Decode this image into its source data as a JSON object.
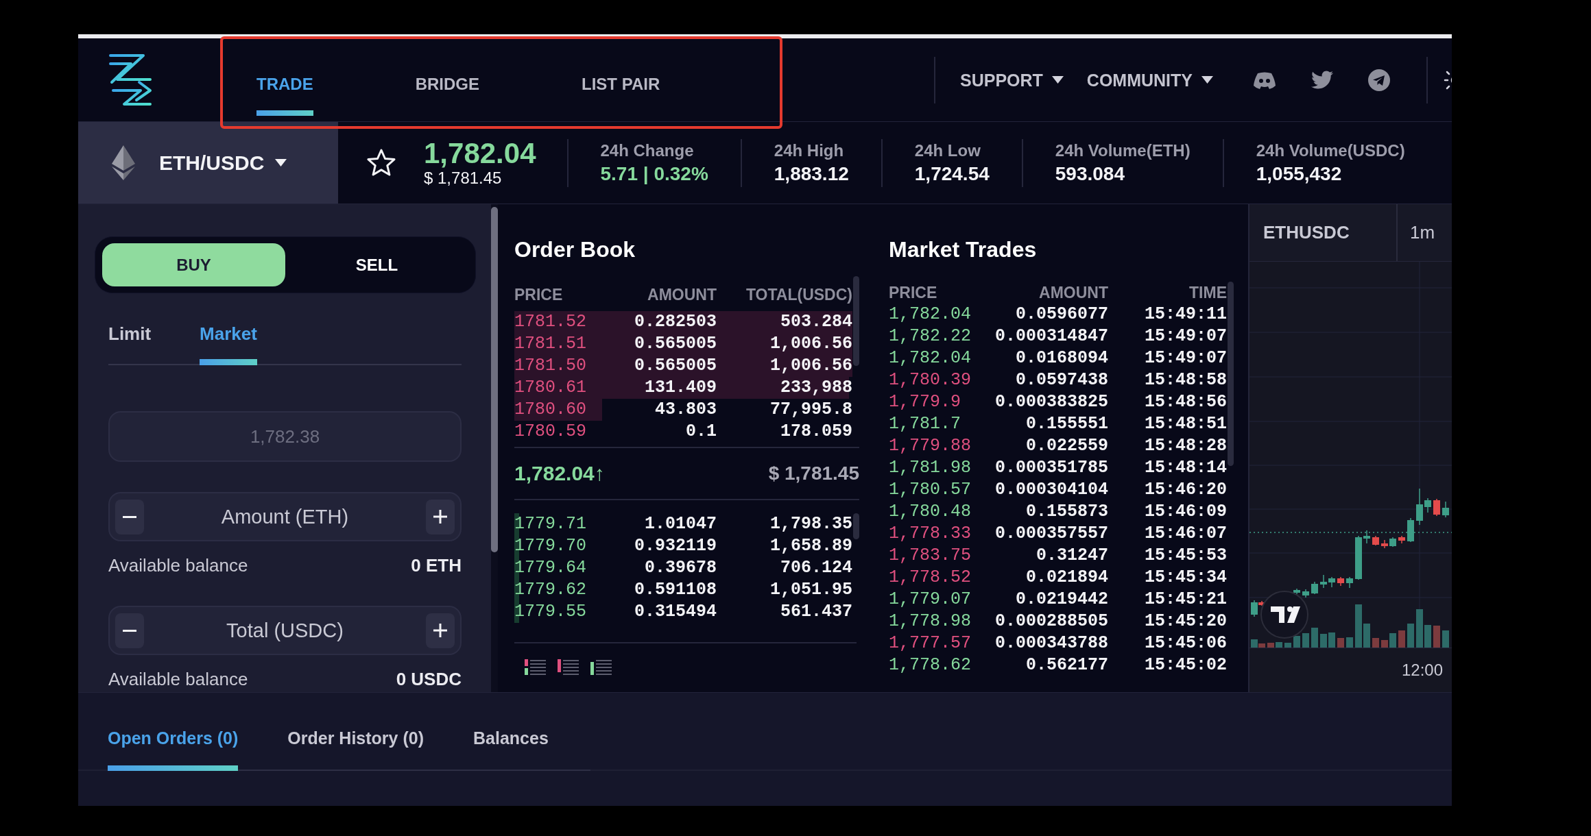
{
  "annotation": {
    "kind": "rectangle"
  },
  "header": {
    "nav_tabs": [
      {
        "label": "TRADE",
        "selected": true
      },
      {
        "label": "BRIDGE",
        "selected": false
      },
      {
        "label": "LIST PAIR",
        "selected": false
      }
    ],
    "menus": [
      {
        "label": "SUPPORT"
      },
      {
        "label": "COMMUNITY"
      }
    ]
  },
  "ticker": {
    "pair": "ETH/USDC",
    "favorite": false,
    "last_price": "1,782.04",
    "last_price_usd": "$ 1,781.45",
    "stats": [
      {
        "label": "24h Change",
        "value": "5.71 | 0.32%",
        "kind": "change"
      },
      {
        "label": "24h High",
        "value": "1,883.12",
        "kind": "plain"
      },
      {
        "label": "24h Low",
        "value": "1,724.54",
        "kind": "plain"
      },
      {
        "label": "24h Volume(ETH)",
        "value": "593.084",
        "kind": "plain"
      },
      {
        "label": "24h Volume(USDC)",
        "value": "1,055,432",
        "kind": "plain"
      }
    ]
  },
  "order_form": {
    "sides": [
      {
        "label": "BUY",
        "selected": true
      },
      {
        "label": "SELL",
        "selected": false
      }
    ],
    "order_types": [
      {
        "label": "Limit",
        "selected": false
      },
      {
        "label": "Market",
        "selected": true
      }
    ],
    "price_field": {
      "placeholder": "1,782.38",
      "disabled": true
    },
    "inputs": [
      {
        "placeholder": "Amount (ETH)",
        "balance_label": "Available balance",
        "balance": "0 ETH"
      },
      {
        "placeholder": "Total (USDC)",
        "balance_label": "Available balance",
        "balance": "0 USDC"
      }
    ]
  },
  "order_book": {
    "title": "Order Book",
    "columns": [
      "PRICE",
      "AMOUNT",
      "TOTAL(USDC)"
    ],
    "asks": [
      {
        "price": "1781.52",
        "amount": "0.282503",
        "total": "503.284"
      },
      {
        "price": "1781.51",
        "amount": "0.565005",
        "total": "1,006.56"
      },
      {
        "price": "1781.50",
        "amount": "0.565005",
        "total": "1,006.56"
      },
      {
        "price": "1780.61",
        "amount": "131.409",
        "total": "233,988"
      },
      {
        "price": "1780.60",
        "amount": "43.803",
        "total": "77,995.8"
      },
      {
        "price": "1780.59",
        "amount": "0.1",
        "total": "178.059"
      }
    ],
    "last_price": "1,782.04↑",
    "last_price_usd": "$ 1,781.45",
    "bids": [
      {
        "price": "1779.71",
        "amount": "1.01047",
        "total": "1,798.35"
      },
      {
        "price": "1779.70",
        "amount": "0.932119",
        "total": "1,658.89"
      },
      {
        "price": "1779.64",
        "amount": "0.39678",
        "total": "706.124"
      },
      {
        "price": "1779.62",
        "amount": "0.591108",
        "total": "1,051.95"
      },
      {
        "price": "1779.55",
        "amount": "0.315494",
        "total": "561.437"
      }
    ]
  },
  "market_trades": {
    "title": "Market Trades",
    "columns": [
      "PRICE",
      "AMOUNT",
      "TIME"
    ],
    "rows": [
      {
        "price": "1,782.04",
        "amount": "0.0596077",
        "time": "15:49:11",
        "color": "#86d99c"
      },
      {
        "price": "1,782.22",
        "amount": "0.000314847",
        "time": "15:49:07",
        "color": "#86d99c"
      },
      {
        "price": "1,782.04",
        "amount": "0.0168094",
        "time": "15:49:07",
        "color": "#86d99c"
      },
      {
        "price": "1,780.39",
        "amount": "0.0597438",
        "time": "15:48:58",
        "color": "#e0507f"
      },
      {
        "price": "1,779.9",
        "amount": "0.000383825",
        "time": "15:48:56",
        "color": "#e0507f"
      },
      {
        "price": "1,781.7",
        "amount": "0.155551",
        "time": "15:48:51",
        "color": "#86d99c"
      },
      {
        "price": "1,779.88",
        "amount": "0.022559",
        "time": "15:48:28",
        "color": "#e0507f"
      },
      {
        "price": "1,781.98",
        "amount": "0.000351785",
        "time": "15:48:14",
        "color": "#86d99c"
      },
      {
        "price": "1,780.57",
        "amount": "0.000304104",
        "time": "15:46:20",
        "color": "#86d99c"
      },
      {
        "price": "1,780.48",
        "amount": "0.155873",
        "time": "15:46:09",
        "color": "#86d99c"
      },
      {
        "price": "1,778.33",
        "amount": "0.000357557",
        "time": "15:46:07",
        "color": "#e0507f"
      },
      {
        "price": "1,783.75",
        "amount": "0.31247",
        "time": "15:45:53",
        "color": "#e0507f"
      },
      {
        "price": "1,778.52",
        "amount": "0.021894",
        "time": "15:45:34",
        "color": "#e0507f"
      },
      {
        "price": "1,779.07",
        "amount": "0.0219442",
        "time": "15:45:21",
        "color": "#86d99c"
      },
      {
        "price": "1,778.98",
        "amount": "0.000288505",
        "time": "15:45:20",
        "color": "#86d99c"
      },
      {
        "price": "1,777.57",
        "amount": "0.000343788",
        "time": "15:45:06",
        "color": "#e0507f"
      },
      {
        "price": "1,778.62",
        "amount": "0.562177",
        "time": "15:45:02",
        "color": "#86d99c"
      }
    ]
  },
  "chart": {
    "symbol": "ETHUSDC",
    "interval": "1m",
    "time_label": "12:00"
  },
  "bottom_tabs": [
    {
      "label": "Open Orders (0)",
      "selected": true
    },
    {
      "label": "Order History (0)",
      "selected": false
    },
    {
      "label": "Balances",
      "selected": false
    }
  ]
}
